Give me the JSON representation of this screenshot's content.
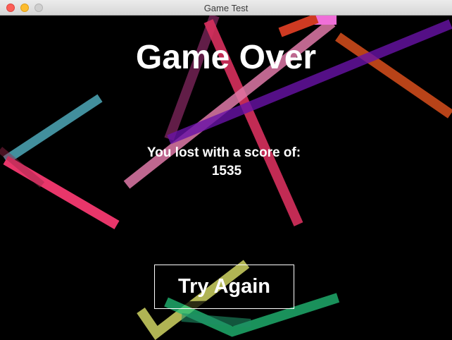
{
  "window": {
    "title": "Game Test"
  },
  "game": {
    "heading": "Game Over",
    "message": "You lost with a score of:",
    "score": "1535",
    "try_again_label": "Try Again"
  },
  "colors": {
    "background": "#000000",
    "text": "#ffffff",
    "streaks": [
      "#e8366a",
      "#4a9fae",
      "#e07aa8",
      "#c8389a",
      "#e6541f",
      "#6a13a8",
      "#dde16a",
      "#23c27a"
    ]
  }
}
